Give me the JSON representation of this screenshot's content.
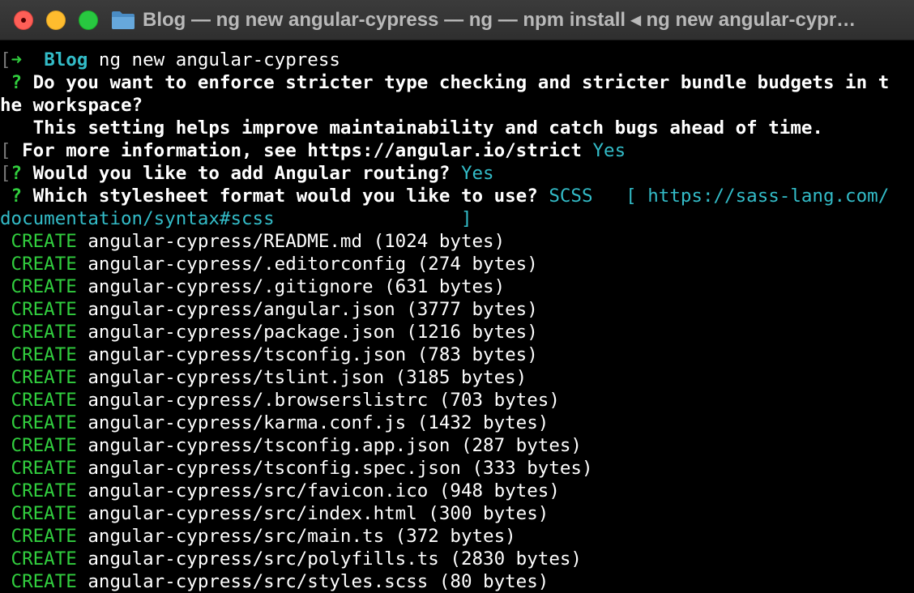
{
  "window": {
    "title": "Blog — ng new angular-cypress — ng — npm install ◂ ng new angular-cypr…"
  },
  "terminal": {
    "prompt": {
      "bracket": "[",
      "arrow": "➜",
      "dir": "Blog",
      "command": "ng new angular-cypress"
    },
    "lines": [
      {
        "margin": "",
        "mark": "? ",
        "question": "Do you want to enforce stricter type checking and stricter bundle budgets in t",
        "answer": ""
      },
      {
        "margin": "",
        "mark": "",
        "question": "he workspace?",
        "answer": ""
      },
      {
        "margin": "",
        "mark": "  ",
        "question": "This setting helps improve maintainability and catch bugs ahead of time.",
        "answer": ""
      },
      {
        "margin": "[",
        "mark": " ",
        "question": "For more information, see https://angular.io/strict",
        "answer": "Yes"
      },
      {
        "margin": "[",
        "mark": "? ",
        "question": "Would you like to add Angular routing?",
        "answer": "Yes"
      },
      {
        "margin": "",
        "mark": "? ",
        "question": "Which stylesheet format would you like to use?",
        "answer": "SCSS   [ https://sass-lang.com/"
      },
      {
        "margin": "",
        "mark": "",
        "question": "",
        "answer": "documentation/syntax#scss                 ]"
      }
    ],
    "create_label": "CREATE",
    "created_files": [
      "angular-cypress/README.md (1024 bytes)",
      "angular-cypress/.editorconfig (274 bytes)",
      "angular-cypress/.gitignore (631 bytes)",
      "angular-cypress/angular.json (3777 bytes)",
      "angular-cypress/package.json (1216 bytes)",
      "angular-cypress/tsconfig.json (783 bytes)",
      "angular-cypress/tslint.json (3185 bytes)",
      "angular-cypress/.browserslistrc (703 bytes)",
      "angular-cypress/karma.conf.js (1432 bytes)",
      "angular-cypress/tsconfig.app.json (287 bytes)",
      "angular-cypress/tsconfig.spec.json (333 bytes)",
      "angular-cypress/src/favicon.ico (948 bytes)",
      "angular-cypress/src/index.html (300 bytes)",
      "angular-cypress/src/main.ts (372 bytes)",
      "angular-cypress/src/polyfills.ts (2830 bytes)",
      "angular-cypress/src/styles.scss (80 bytes)"
    ]
  },
  "colors": {
    "background": "#000000",
    "titlebar": "#353535",
    "title_text": "#b9b9b9",
    "green": "#31ce3e",
    "cyan": "#33bcc8",
    "close": "#fe5f57",
    "minimize": "#febc2e",
    "maximize": "#28c840",
    "folder": "#5a9fd4"
  },
  "icons": {
    "close": "close-icon",
    "minimize": "minimize-icon",
    "maximize": "maximize-icon",
    "folder": "folder-icon"
  }
}
